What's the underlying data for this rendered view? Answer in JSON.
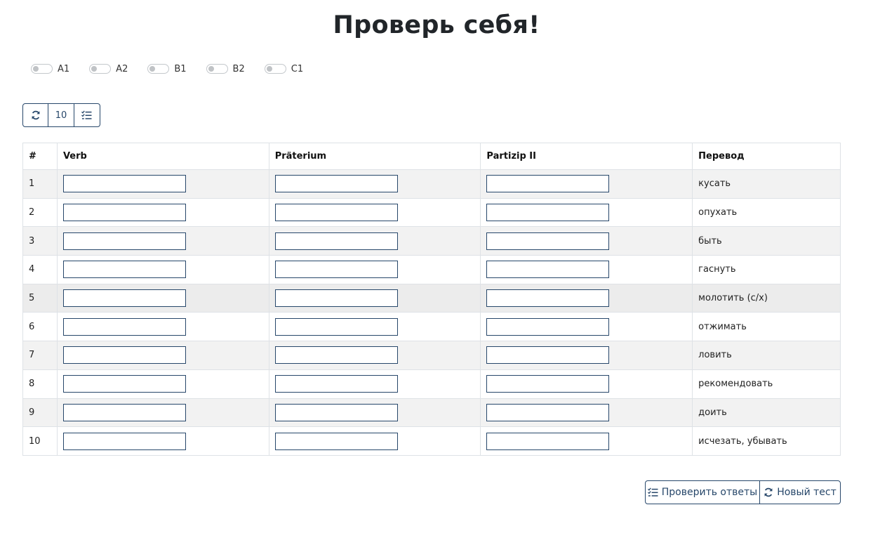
{
  "page": {
    "title": "Проверь себя!"
  },
  "levels": [
    {
      "label": "A1",
      "checked": false
    },
    {
      "label": "A2",
      "checked": false
    },
    {
      "label": "B1",
      "checked": false
    },
    {
      "label": "B2",
      "checked": false
    },
    {
      "label": "C1",
      "checked": false
    }
  ],
  "toolbar": {
    "refresh_icon": "refresh-icon",
    "count_label": "10",
    "checklist_icon": "checklist-icon"
  },
  "table": {
    "headers": {
      "num": "#",
      "verb": "Verb",
      "prateritum": "Präterium",
      "partizip": "Partizip II",
      "translation": "Перевод"
    },
    "rows": [
      {
        "num": "1",
        "translation": "кусать"
      },
      {
        "num": "2",
        "translation": "опухать"
      },
      {
        "num": "3",
        "translation": "быть"
      },
      {
        "num": "4",
        "translation": "гаснуть"
      },
      {
        "num": "5",
        "translation": "молотить (с/х)"
      },
      {
        "num": "6",
        "translation": "отжимать"
      },
      {
        "num": "7",
        "translation": "ловить"
      },
      {
        "num": "8",
        "translation": "рекомендовать"
      },
      {
        "num": "9",
        "translation": "доить"
      },
      {
        "num": "10",
        "translation": "исчезать, убывать"
      }
    ]
  },
  "actions": {
    "check_label": "Проверить ответы",
    "new_test_label": "Новый тест"
  },
  "colors": {
    "accent": "#27476a",
    "stripe": "#f2f2f2",
    "border": "#dee2e6"
  }
}
